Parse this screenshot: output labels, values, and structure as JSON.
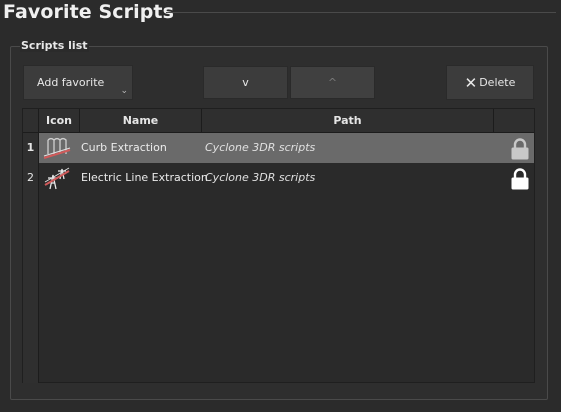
{
  "panel": {
    "title": "Favorite Scripts",
    "group_label": "Scripts list"
  },
  "toolbar": {
    "add_label": "Add favorite",
    "add_chevron": "⌄",
    "down_label": "v",
    "up_label": "^",
    "delete_icon": "✕",
    "delete_label": "Delete"
  },
  "table": {
    "columns": {
      "icon": "Icon",
      "name": "Name",
      "path": "Path"
    },
    "rows": [
      {
        "num": "1",
        "icon": "curb-extraction-icon",
        "name": "Curb Extraction",
        "path": "Cyclone 3DR scripts",
        "locked": true,
        "selected": true
      },
      {
        "num": "2",
        "icon": "electric-line-extraction-icon",
        "name": "Electric Line Extraction",
        "path": "Cyclone 3DR scripts",
        "locked": true,
        "selected": false
      }
    ]
  },
  "colors": {
    "background": "#2b2b2b",
    "selected_row": "#6a6a6a",
    "lock_selected": "#c8c8c8",
    "lock_normal": "#ffffff"
  }
}
